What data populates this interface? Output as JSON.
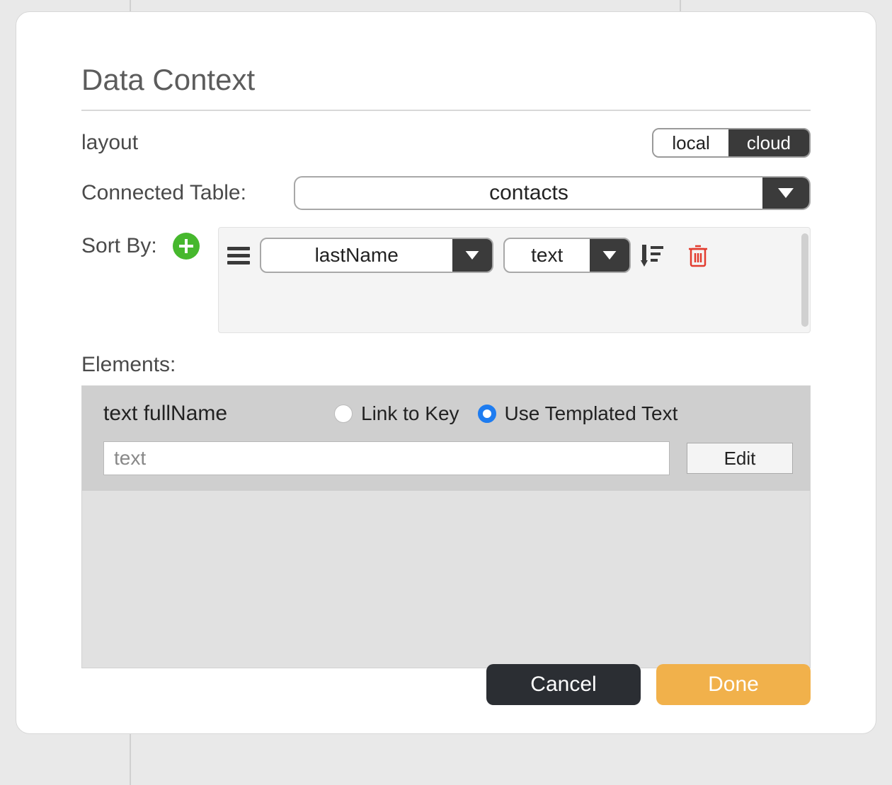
{
  "dialog": {
    "title": "Data Context",
    "layout_label": "layout",
    "layout_toggle": {
      "local": "local",
      "cloud": "cloud",
      "selected": "cloud"
    },
    "connected_table_label": "Connected Table:",
    "connected_table_value": "contacts",
    "sort_by_label": "Sort By:",
    "sort_items": [
      {
        "field": "lastName",
        "type": "text"
      }
    ],
    "elements_label": "Elements:",
    "element": {
      "title": "text fullName",
      "radio_link_label": "Link to Key",
      "radio_template_label": "Use Templated Text",
      "selected_radio": "template",
      "text_placeholder": "text",
      "edit_label": "Edit"
    },
    "buttons": {
      "cancel": "Cancel",
      "done": "Done"
    }
  }
}
